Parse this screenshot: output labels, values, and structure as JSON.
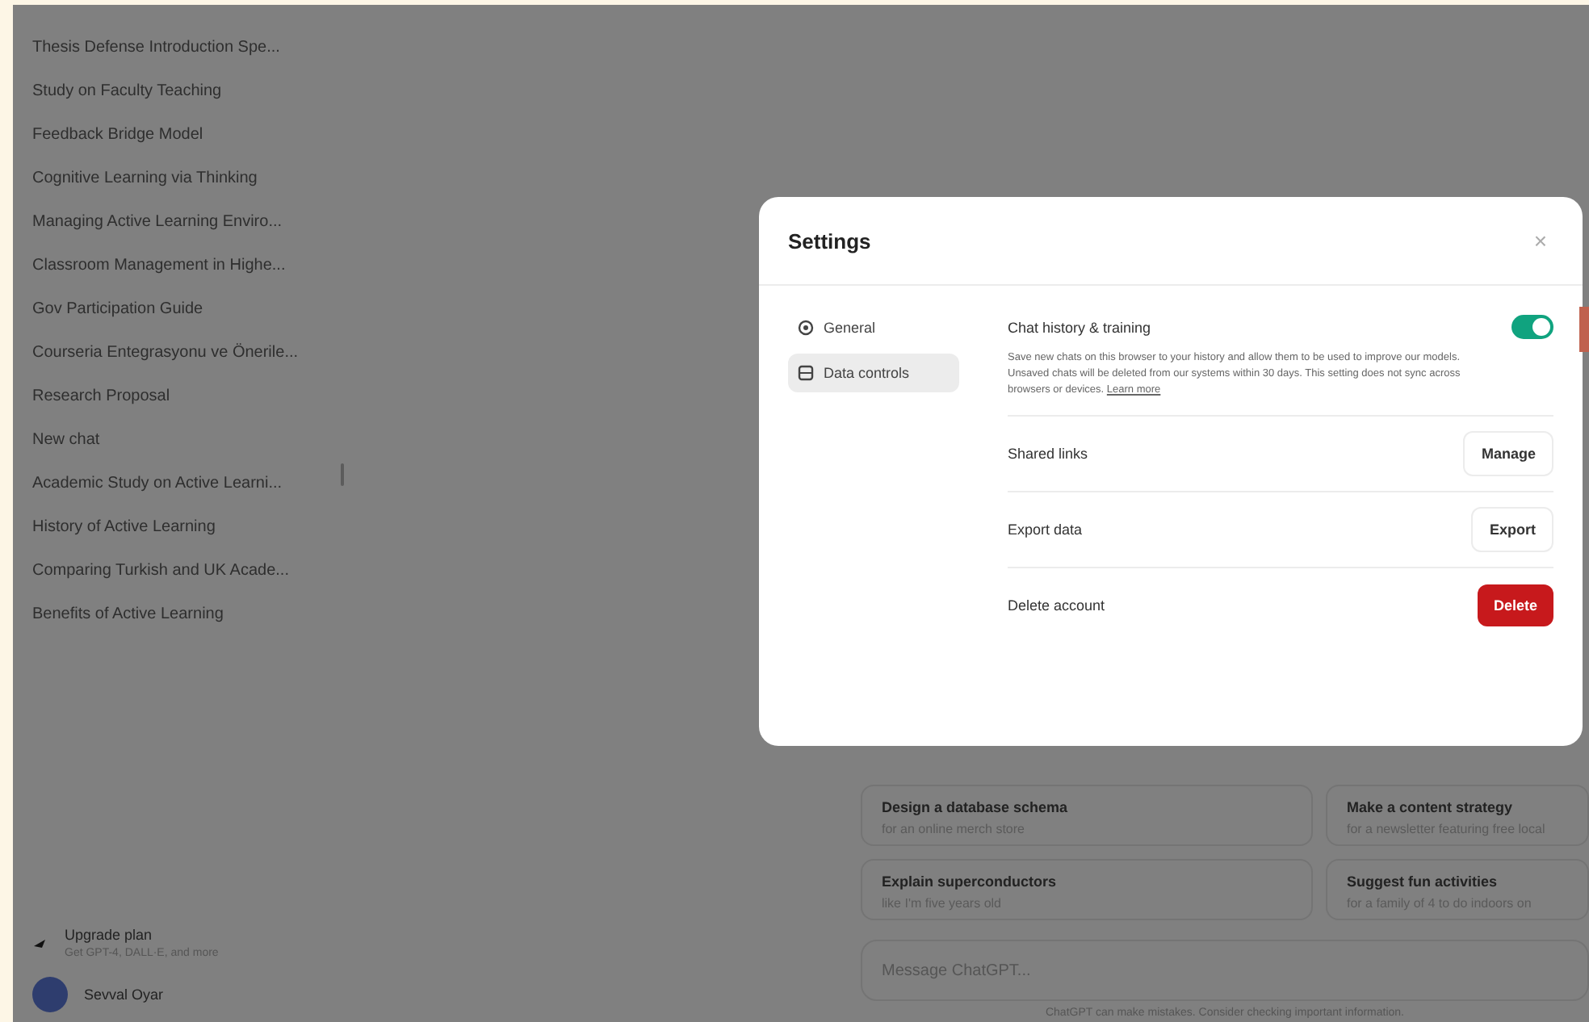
{
  "sidebar": {
    "chats": [
      {
        "title": "Thesis Defense Introduction Spe..."
      },
      {
        "title": "Study on Faculty Teaching"
      },
      {
        "title": "Feedback Bridge Model"
      },
      {
        "title": "Cognitive Learning via Thinking"
      },
      {
        "title": "Managing Active Learning Enviro..."
      },
      {
        "title": "Classroom Management in Highe..."
      },
      {
        "title": "Gov Participation Guide"
      },
      {
        "title": "Courseria Entegrasyonu ve Önerile..."
      },
      {
        "title": "Research Proposal"
      },
      {
        "title": "New chat"
      },
      {
        "title": "Academic Study on Active Learni..."
      },
      {
        "title": "History of Active Learning"
      },
      {
        "title": "Comparing Turkish and UK Acade..."
      },
      {
        "title": "Benefits of Active Learning"
      }
    ],
    "upgrade": {
      "title": "Upgrade plan",
      "subtitle": "Get GPT-4, DALL·E, and more"
    },
    "user": {
      "name": "Sevval Oyar"
    }
  },
  "main": {
    "suggestions": [
      {
        "title": "Design a database schema",
        "subtitle": "for an online merch store"
      },
      {
        "title": "Make a content strategy",
        "subtitle": "for a newsletter featuring free local"
      },
      {
        "title": "Explain superconductors",
        "subtitle": "like I'm five years old"
      },
      {
        "title": "Suggest fun activities",
        "subtitle": "for a family of 4 to do indoors on"
      }
    ],
    "composer": {
      "placeholder": "Message ChatGPT..."
    },
    "footer": "ChatGPT can make mistakes. Consider checking important information."
  },
  "settings": {
    "title": "Settings",
    "close": "×",
    "tabs": [
      {
        "label": "General",
        "selected": false
      },
      {
        "label": "Data controls",
        "selected": true
      }
    ],
    "history": {
      "label": "Chat history & training",
      "on": true,
      "description": "Save new chats on this browser to your history and allow them to be used to improve our models. Unsaved chats will be deleted from our systems within 30 days. This setting does not sync across browsers or devices.",
      "link": "Learn more"
    },
    "rows": [
      {
        "label": "Shared links",
        "button": "Manage",
        "kind": "normal"
      },
      {
        "label": "Export data",
        "button": "Export",
        "kind": "normal"
      },
      {
        "label": "Delete account",
        "button": "Delete",
        "kind": "danger"
      }
    ]
  }
}
